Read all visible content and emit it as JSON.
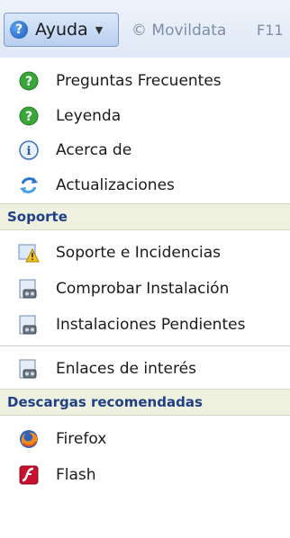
{
  "toolbar": {
    "help_label": "Ayuda",
    "copyright": "© Movildata",
    "fkey": "F11"
  },
  "menu": {
    "items_top": [
      {
        "label": "Preguntas Frecuentes",
        "icon": "green-question-icon"
      },
      {
        "label": "Leyenda",
        "icon": "green-question-icon"
      },
      {
        "label": "Acerca de",
        "icon": "info-icon"
      },
      {
        "label": "Actualizaciones",
        "icon": "refresh-icon"
      }
    ],
    "section_support": "Soporte",
    "items_support": [
      {
        "label": "Soporte e Incidencias",
        "icon": "warning-icon"
      },
      {
        "label": "Comprobar Instalación",
        "icon": "installer-icon"
      },
      {
        "label": "Instalaciones Pendientes",
        "icon": "installer-icon"
      },
      {
        "label": "Enlaces de interés",
        "icon": "installer-icon"
      }
    ],
    "section_downloads": "Descargas recomendadas",
    "items_downloads": [
      {
        "label": "Firefox",
        "icon": "firefox-icon"
      },
      {
        "label": "Flash",
        "icon": "flash-icon"
      }
    ]
  },
  "colors": {
    "section_bg": "#eef0e0",
    "section_text": "#1f3f86",
    "toolbar_bg": "#dfe8f5"
  }
}
